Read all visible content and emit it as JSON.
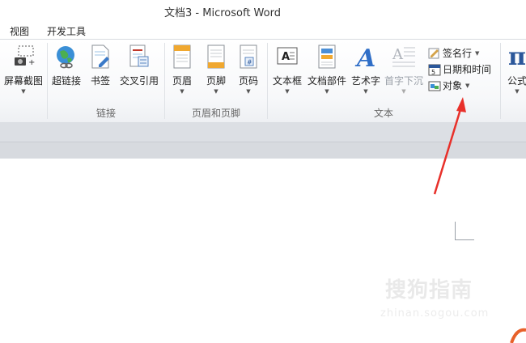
{
  "window": {
    "title": "文档3 - Microsoft Word"
  },
  "menu": {
    "items": [
      "视图",
      "开发工具"
    ]
  },
  "ribbon": {
    "groups": {
      "illustration_partial": {
        "screenshot_label": "屏幕截图"
      },
      "links": {
        "label": "链接",
        "hyperlink": "超链接",
        "bookmark": "书签",
        "crossref": "交叉引用"
      },
      "header_footer": {
        "label": "页眉和页脚",
        "header": "页眉",
        "footer": "页脚",
        "page_number": "页码"
      },
      "text": {
        "label": "文本",
        "textbox": "文本框",
        "quickparts": "文档部件",
        "wordart": "艺术字",
        "dropcap": "首字下沉",
        "signature_line": "签名行",
        "datetime": "日期和时间",
        "object": "对象"
      },
      "symbols_partial": {
        "equation": "公式"
      }
    }
  },
  "watermark": {
    "text": "搜狗指南",
    "sub": "zhinan.sogou.com"
  },
  "colors": {
    "arrow": "#e8302a",
    "accent": "#2b579a"
  }
}
